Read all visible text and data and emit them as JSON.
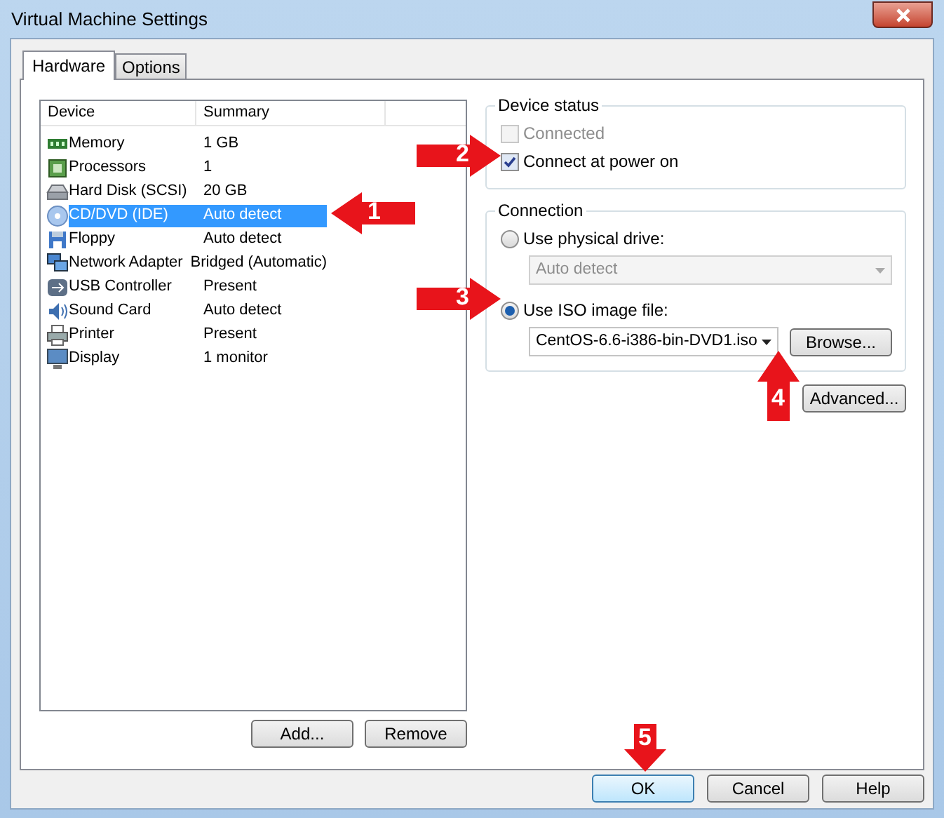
{
  "window": {
    "title": "Virtual Machine Settings"
  },
  "tabs": [
    {
      "label": "Hardware",
      "selected": true
    },
    {
      "label": "Options",
      "selected": false
    }
  ],
  "device_list": {
    "columns": [
      "Device",
      "Summary"
    ],
    "rows": [
      {
        "kind": "memory",
        "device": "Memory",
        "summary": "1 GB",
        "selected": false
      },
      {
        "kind": "processor",
        "device": "Processors",
        "summary": "1",
        "selected": false
      },
      {
        "kind": "disk",
        "device": "Hard Disk (SCSI)",
        "summary": "20 GB",
        "selected": false
      },
      {
        "kind": "disc",
        "device": "CD/DVD (IDE)",
        "summary": "Auto detect",
        "selected": true
      },
      {
        "kind": "floppy",
        "device": "Floppy",
        "summary": "Auto detect",
        "selected": false
      },
      {
        "kind": "network",
        "device": "Network Adapter",
        "summary": "Bridged (Automatic)",
        "selected": false
      },
      {
        "kind": "usb",
        "device": "USB Controller",
        "summary": "Present",
        "selected": false
      },
      {
        "kind": "sound",
        "device": "Sound Card",
        "summary": "Auto detect",
        "selected": false
      },
      {
        "kind": "printer",
        "device": "Printer",
        "summary": "Present",
        "selected": false
      },
      {
        "kind": "display",
        "device": "Display",
        "summary": "1 monitor",
        "selected": false
      }
    ]
  },
  "list_buttons": [
    "Add...",
    "Remove"
  ],
  "device_status": {
    "title": "Device status",
    "options": [
      {
        "label": "Connected",
        "checked": false,
        "disabled": true
      },
      {
        "label": "Connect at power on",
        "checked": true,
        "disabled": false
      }
    ]
  },
  "connection": {
    "title": "Connection",
    "options": [
      {
        "label": "Use physical drive:",
        "selected": false,
        "field": {
          "value": "Auto detect",
          "disabled": true
        }
      },
      {
        "label": "Use ISO image file:",
        "selected": true,
        "field": {
          "value": "CentOS-6.6-i386-bin-DVD1.iso",
          "disabled": false
        },
        "button": "Browse..."
      }
    ]
  },
  "advanced_button": "Advanced...",
  "dialog_buttons": [
    {
      "label": "OK",
      "default": true
    },
    {
      "label": "Cancel",
      "default": false
    },
    {
      "label": "Help",
      "default": false
    }
  ],
  "annotations": [
    {
      "number": "1"
    },
    {
      "number": "2"
    },
    {
      "number": "3"
    },
    {
      "number": "4"
    },
    {
      "number": "5"
    }
  ]
}
